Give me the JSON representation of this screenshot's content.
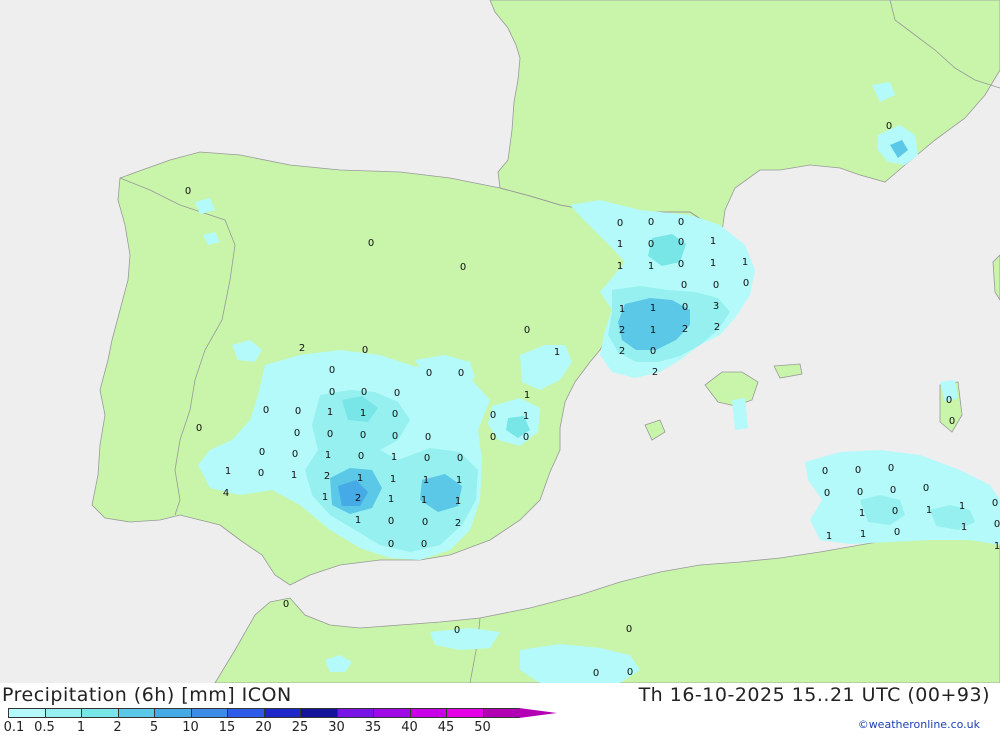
{
  "header": {
    "title": "Precipitation (6h) [mm] ICON",
    "datetime": "Th 16-10-2025 15..21 UTC (00+93)",
    "credit": "©weatheronline.co.uk"
  },
  "legend": {
    "labels": [
      "0.1",
      "0.5",
      "1",
      "2",
      "5",
      "10",
      "15",
      "20",
      "25",
      "30",
      "35",
      "40",
      "45",
      "50"
    ],
    "colors": [
      "#b4fafa",
      "#96f0f0",
      "#78e6e6",
      "#5ac8e6",
      "#46aae6",
      "#3c8ce6",
      "#2d5ae6",
      "#1e28c8",
      "#14149b",
      "#7814e6",
      "#a00ae6",
      "#c800e6",
      "#e600e6",
      "#b400b4"
    ]
  },
  "map": {
    "colors": {
      "sea": "#eeeeee",
      "land": "#c8f5aa",
      "border": "#999999"
    },
    "values": [
      "0",
      "0",
      "0",
      "0",
      "0",
      "0",
      "0",
      "1",
      "0",
      "0",
      "1",
      "1",
      "1",
      "0",
      "1",
      "1",
      "0",
      "0",
      "0",
      "1",
      "1",
      "1",
      "0",
      "3",
      "2",
      "1",
      "2",
      "2",
      "2",
      "0",
      "2",
      "2",
      "0",
      "0",
      "0",
      "0",
      "0",
      "0",
      "0",
      "1",
      "0",
      "0",
      "1",
      "1",
      "0",
      "0",
      "1",
      "0",
      "0",
      "0",
      "0",
      "0",
      "0",
      "0",
      "0",
      "0",
      "0",
      "1",
      "0",
      "1",
      "0",
      "0",
      "1",
      "0",
      "1",
      "2",
      "1",
      "1",
      "1",
      "1",
      "4",
      "1",
      "2",
      "1",
      "1",
      "1",
      "1",
      "0",
      "0",
      "2",
      "0",
      "0",
      "0",
      "0",
      "0",
      "0",
      "0",
      "0",
      "0",
      "0",
      "0",
      "0",
      "1",
      "0",
      "1",
      "1",
      "0",
      "1",
      "1",
      "0",
      "1",
      "0",
      "0",
      "0",
      "0",
      "0",
      "0",
      "1"
    ]
  }
}
